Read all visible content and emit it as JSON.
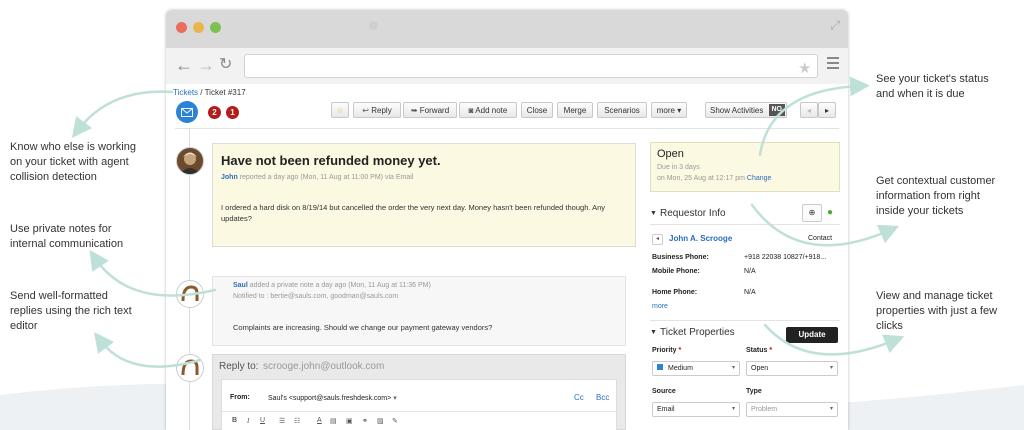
{
  "browser": {
    "address": ""
  },
  "breadcrumb": {
    "root": "Tickets",
    "separator": " / ",
    "current": "Ticket #317"
  },
  "badges": {
    "agents": "2",
    "alerts": "1"
  },
  "toolbar": {
    "reply": "Reply",
    "forward": "Forward",
    "add_note": "Add note",
    "close": "Close",
    "merge": "Merge",
    "scenarios": "Scenarios",
    "more": "more",
    "show_activities": "Show Activities",
    "toggle": "NO"
  },
  "ticket": {
    "subject": "Have not been refunded money yet.",
    "author": "John",
    "meta": " reported a day ago (Mon, 11 Aug at 11:00 PM) via Email",
    "body": "I ordered a hard disk on 8/19/14 but cancelled the order the very next day. Money hasn't been refunded though. Any updates?"
  },
  "note": {
    "author": "Saul",
    "meta": " added a private note a day ago (Mon, 11 Aug at 11:36 PM)",
    "notified": "Notified to : bertie@sauls.com, goodman@sauls.com",
    "body": "Complaints are increasing. Should we change our payment gateway vendors?"
  },
  "reply": {
    "to_label": "Reply to:",
    "to_value": "scrooge.john@outlook.com",
    "from_label": "From:",
    "from_value": "Saul's <support@sauls.freshdesk.com>",
    "cc": "Cc",
    "bcc": "Bcc"
  },
  "status_box": {
    "status": "Open",
    "due": "Due in 3 days",
    "due_date": "on Mon, 25 Aug at 12:17 pm",
    "change": "Change"
  },
  "requestor": {
    "title": "Requestor Info",
    "name": "John A. Scrooge",
    "contact": "Contact",
    "fields": [
      {
        "label": "Business Phone:",
        "value": "+918 22038 10827/+918..."
      },
      {
        "label": "Mobile Phone:",
        "value": "N/A"
      },
      {
        "label": "Home Phone:",
        "value": "N/A"
      }
    ],
    "more": "more"
  },
  "properties": {
    "title": "Ticket Properties",
    "update": "Update",
    "priority_label": "Priority",
    "priority_value": "Medium",
    "status_label": "Status",
    "status_value": "Open",
    "source_label": "Source",
    "source_value": "Email",
    "type_label": "Type",
    "type_value": "Problem",
    "required": "*"
  },
  "annotations": {
    "status_due": [
      "See your ticket's status",
      "and when it is due"
    ],
    "collision": [
      "Know who else is working",
      "on your ticket with agent",
      "collision detection"
    ],
    "customer_info": [
      "Get contextual customer",
      "information from right",
      "inside your tickets"
    ],
    "private_notes": [
      "Use private notes for",
      "internal communication"
    ],
    "rich_text": [
      "Send well-formatted",
      "replies using the rich text",
      "editor"
    ],
    "properties": [
      "View and manage ticket",
      "properties with just a few",
      "clicks"
    ]
  },
  "colors": {
    "accent": "#2a6ebb",
    "arrow": "#bfe0d8",
    "note_bg": "#fbf9e2",
    "badge": "#b41c1c",
    "update_button": "#222222"
  }
}
